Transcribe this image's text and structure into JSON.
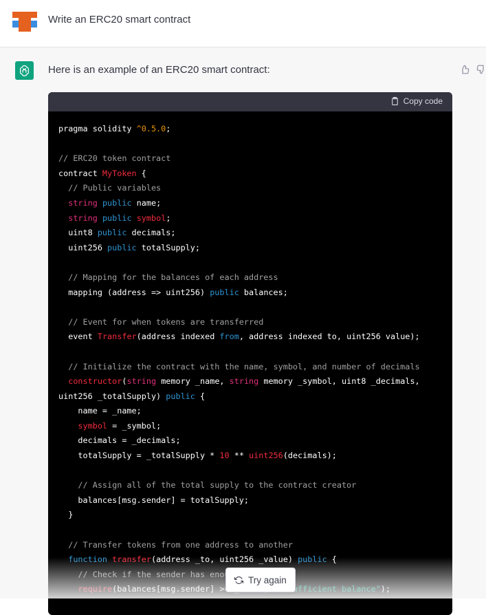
{
  "user_message": {
    "text": "Write an ERC20 smart contract"
  },
  "assistant": {
    "intro": "Here is an example of an ERC20 smart contract:",
    "copy_label": "Copy code"
  },
  "code_lines": [
    [
      [
        "pragma solidity ",
        ""
      ],
      [
        "^0.5.0",
        "num"
      ],
      [
        ";",
        ""
      ]
    ],
    [],
    [
      [
        "// ERC20 token contract",
        "cm"
      ]
    ],
    [
      [
        "contract ",
        ""
      ],
      [
        "MyToken",
        "name"
      ],
      [
        " {",
        ""
      ]
    ],
    [
      [
        "  ",
        ""
      ],
      [
        "// Public variables",
        "cm"
      ]
    ],
    [
      [
        "  ",
        ""
      ],
      [
        "string",
        "kw"
      ],
      [
        " ",
        ""
      ],
      [
        "public",
        "pub"
      ],
      [
        " name;",
        ""
      ]
    ],
    [
      [
        "  ",
        ""
      ],
      [
        "string",
        "kw"
      ],
      [
        " ",
        ""
      ],
      [
        "public",
        "pub"
      ],
      [
        " ",
        ""
      ],
      [
        "symbol",
        "name"
      ],
      [
        ";",
        ""
      ]
    ],
    [
      [
        "  uint8 ",
        ""
      ],
      [
        "public",
        "pub"
      ],
      [
        " decimals;",
        ""
      ]
    ],
    [
      [
        "  uint256 ",
        ""
      ],
      [
        "public",
        "pub"
      ],
      [
        " totalSupply;",
        ""
      ]
    ],
    [],
    [
      [
        "  ",
        ""
      ],
      [
        "// Mapping for the balances of each address",
        "cm"
      ]
    ],
    [
      [
        "  mapping (address => uint256) ",
        ""
      ],
      [
        "public",
        "pub"
      ],
      [
        " balances;",
        ""
      ]
    ],
    [],
    [
      [
        "  ",
        ""
      ],
      [
        "// Event for when tokens are transferred",
        "cm"
      ]
    ],
    [
      [
        "  event ",
        ""
      ],
      [
        "Transfer",
        "name"
      ],
      [
        "(address indexed ",
        ""
      ],
      [
        "from",
        "pub"
      ],
      [
        ", address indexed to, uint256 value);",
        ""
      ]
    ],
    [],
    [
      [
        "  ",
        ""
      ],
      [
        "// Initialize the contract with the name, symbol, and number of decimals",
        "cm"
      ]
    ],
    [
      [
        "  ",
        ""
      ],
      [
        "constructor",
        "name"
      ],
      [
        "(",
        ""
      ],
      [
        "string",
        "kw"
      ],
      [
        " memory _name, ",
        ""
      ],
      [
        "string",
        "kw"
      ],
      [
        " memory _symbol, uint8 _decimals,",
        ""
      ]
    ],
    [
      [
        "uint256 _totalSupply) ",
        ""
      ],
      [
        "public",
        "pub"
      ],
      [
        " {",
        ""
      ]
    ],
    [
      [
        "    name = _name;",
        ""
      ]
    ],
    [
      [
        "    ",
        ""
      ],
      [
        "symbol",
        "name"
      ],
      [
        " = _symbol;",
        ""
      ]
    ],
    [
      [
        "    decimals = _decimals;",
        ""
      ]
    ],
    [
      [
        "    totalSupply = _totalSupply * ",
        ""
      ],
      [
        "10",
        "name"
      ],
      [
        " ** ",
        ""
      ],
      [
        "uint256",
        "name"
      ],
      [
        "(decimals);",
        ""
      ]
    ],
    [],
    [
      [
        "    ",
        ""
      ],
      [
        "// Assign all of the total supply to the contract creator",
        "cm"
      ]
    ],
    [
      [
        "    balances[msg.sender] = totalSupply;",
        ""
      ]
    ],
    [
      [
        "  }",
        ""
      ]
    ],
    [],
    [
      [
        "  ",
        ""
      ],
      [
        "// Transfer tokens from one address to another",
        "cm"
      ]
    ],
    [
      [
        "  ",
        ""
      ],
      [
        "function",
        "pub"
      ],
      [
        " ",
        ""
      ],
      [
        "transfer",
        "name"
      ],
      [
        "(address _to, uint256 _value) ",
        ""
      ],
      [
        "public",
        "pub"
      ],
      [
        " {",
        ""
      ]
    ],
    [
      [
        "    ",
        ""
      ],
      [
        "// Check if the sender has enough",
        "cm"
      ]
    ],
    [
      [
        "    ",
        ""
      ],
      [
        "require",
        "name"
      ],
      [
        "(balances[msg.sender] >= _value, ",
        ""
      ],
      [
        "\"Insufficient balance\"",
        "str"
      ],
      [
        ");",
        ""
      ]
    ]
  ],
  "try_again": {
    "label": "Try again"
  },
  "colors": {
    "assistant_avatar": "#10a37f",
    "code_bg": "#000000",
    "code_header_bg": "#343541"
  }
}
